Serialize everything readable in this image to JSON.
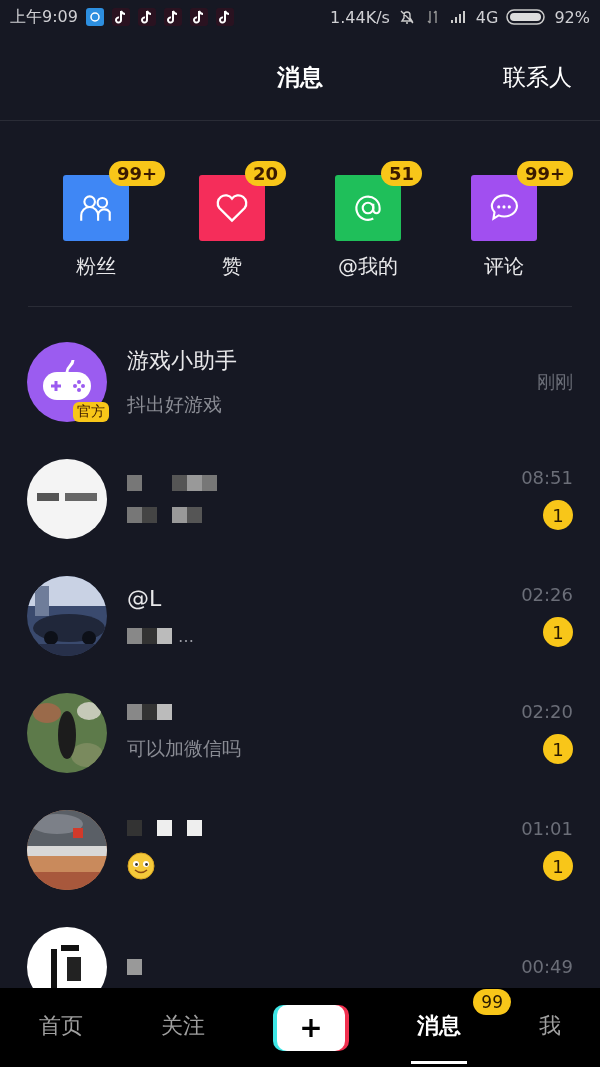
{
  "status_bar": {
    "time": "上午9:09",
    "speed": "1.44K/s",
    "network": "4G",
    "battery": "92%"
  },
  "header": {
    "title": "消息",
    "action": "联系人"
  },
  "shortcuts": [
    {
      "kind": "fans",
      "label": "粉丝",
      "count": "99+",
      "color": "#3f87f5"
    },
    {
      "kind": "likes",
      "label": "赞",
      "count": "20",
      "color": "#f52d5a"
    },
    {
      "kind": "mentions",
      "label": "@我的",
      "count": "51",
      "color": "#1fbf5a"
    },
    {
      "kind": "comments",
      "label": "评论",
      "count": "99+",
      "color": "#a14ff0"
    }
  ],
  "conversations": [
    {
      "avatar": {
        "kind": "game"
      },
      "name": "游戏小助手",
      "name_blurred": false,
      "official_badge": "官方",
      "message": {
        "kind": "text",
        "text": "抖出好游戏"
      },
      "time": "刚刚"
    },
    {
      "name_blurred": true,
      "message": {
        "kind": "blurred"
      },
      "time": "08:51",
      "unread": "1"
    },
    {
      "name": "@L",
      "name_blurred": false,
      "message": {
        "kind": "blurred",
        "ellipsis": "…"
      },
      "time": "02:26",
      "unread": "1"
    },
    {
      "name_blurred": true,
      "message": {
        "kind": "text",
        "text": "可以加微信吗"
      },
      "time": "02:20",
      "unread": "1"
    },
    {
      "name_blurred": true,
      "message": {
        "kind": "emoji"
      },
      "time": "01:01",
      "unread": "1"
    },
    {
      "name_blurred": true,
      "time": "00:49"
    }
  ],
  "tab_bar": [
    {
      "kind": "tab",
      "label": "首页",
      "selected": false
    },
    {
      "kind": "tab",
      "label": "关注",
      "selected": false
    },
    {
      "kind": "create",
      "label": "+"
    },
    {
      "kind": "tab",
      "label": "消息",
      "selected": true,
      "badge": "99"
    },
    {
      "kind": "tab",
      "label": "我",
      "selected": false
    }
  ]
}
